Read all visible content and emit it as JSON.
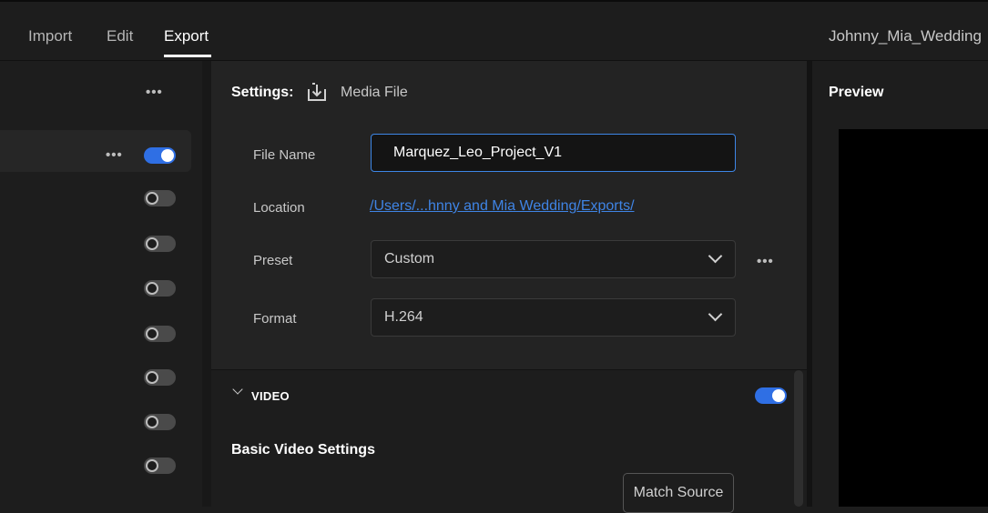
{
  "header": {
    "tabs": [
      {
        "label": "Import"
      },
      {
        "label": "Edit"
      },
      {
        "label": "Export"
      }
    ],
    "active_tab": "Export",
    "project_name": "Johnny_Mia_Wedding"
  },
  "left_panel": {
    "more_label": "•••",
    "row_more_label": "•••",
    "destinations": [
      {
        "enabled": true
      },
      {
        "enabled": false
      },
      {
        "enabled": false
      },
      {
        "enabled": false
      },
      {
        "enabled": false
      },
      {
        "enabled": false
      },
      {
        "enabled": false
      },
      {
        "enabled": false
      }
    ]
  },
  "settings": {
    "title": "Settings:",
    "destination": "Media File",
    "file_name_label": "File Name",
    "file_name_value": "Marquez_Leo_Project_V1",
    "location_label": "Location",
    "location_value": "/Users/...hnny and Mia Wedding/Exports/",
    "preset_label": "Preset",
    "preset_value": "Custom",
    "preset_more_label": "•••",
    "format_label": "Format",
    "format_value": "H.264"
  },
  "video": {
    "section_label": "VIDEO",
    "enabled": true,
    "basic_title": "Basic Video Settings",
    "match_source_label": "Match Source"
  },
  "preview": {
    "title": "Preview"
  },
  "colors": {
    "accent": "#2f6fe4",
    "link": "#3f84e5",
    "background": "#1d1d1d",
    "panel": "#232323"
  }
}
